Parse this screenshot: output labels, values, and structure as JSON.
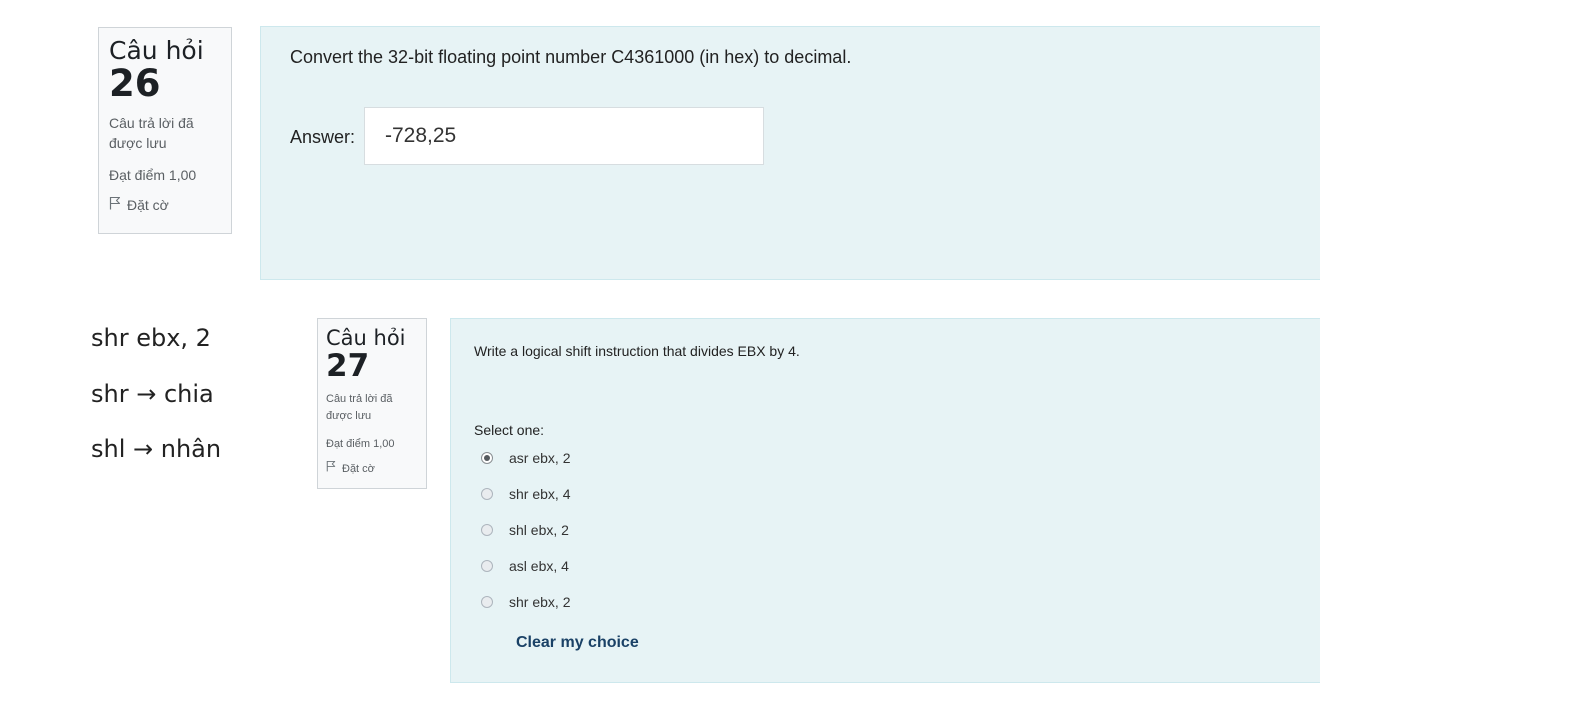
{
  "question26": {
    "info": {
      "title": "Câu hỏi",
      "number": "26",
      "state": "Câu trả lời đã được lưu",
      "grade": "Đạt điểm 1,00",
      "flag_label": "Đặt cờ"
    },
    "text": "Convert the 32-bit floating point number C4361000 (in hex) to decimal.",
    "answer_label": "Answer:",
    "answer_value": "-728,25"
  },
  "question27": {
    "info": {
      "title": "Câu hỏi",
      "number": "27",
      "state": "Câu trả lời đã được lưu",
      "grade": "Đạt điểm 1,00",
      "flag_label": "Đặt cờ"
    },
    "text": "Write a logical shift instruction that divides EBX by 4.",
    "select_label": "Select one:",
    "options": [
      {
        "label": "asr ebx, 2",
        "selected": true
      },
      {
        "label": "shr ebx, 4",
        "selected": false
      },
      {
        "label": "shl ebx, 2",
        "selected": false
      },
      {
        "label": "asl ebx, 4",
        "selected": false
      },
      {
        "label": "shr ebx, 2",
        "selected": false
      }
    ],
    "clear_label": "Clear my choice"
  },
  "notes": [
    "shr ebx, 2",
    "shr → chia",
    "shl → nhân"
  ],
  "icons": {
    "flag": "flag-icon",
    "radio": "radio-button-icon"
  },
  "colors": {
    "panel_background": "#e7f3f5",
    "info_background": "#f8f9fa",
    "link": "#1a4166"
  }
}
